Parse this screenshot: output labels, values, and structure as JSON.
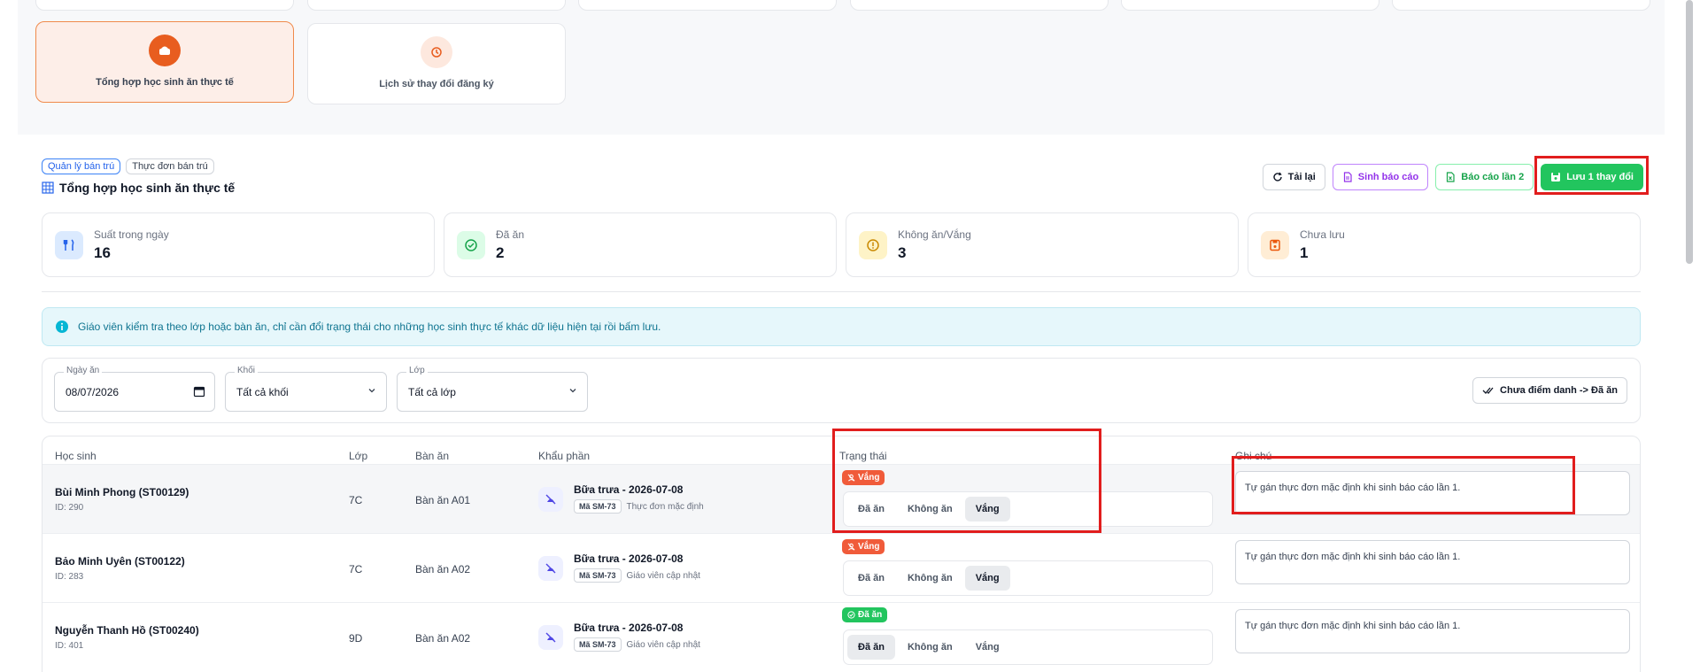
{
  "tiles": [
    {
      "label": "Tổng hợp học sinh ăn thực tế",
      "icon": "meal-box-icon",
      "active": true
    },
    {
      "label": "Lịch sử thay đổi đăng ký",
      "icon": "history-icon",
      "active": false
    }
  ],
  "breadcrumbs": [
    "Quản lý bán trú",
    "Thực đơn bán trú"
  ],
  "page_title": "Tổng hợp học sinh ăn thực tế",
  "actions": {
    "reload": "Tải lại",
    "generate_report": "Sinh báo cáo",
    "report_round2": "Báo cáo lần 2",
    "save": "Lưu 1 thay đổi"
  },
  "stats": [
    {
      "label": "Suất trong ngày",
      "value": "16",
      "icon": "utensils-icon",
      "color": "#3b82f6"
    },
    {
      "label": "Đã ăn",
      "value": "2",
      "icon": "check-circle-icon",
      "color": "#22c55e"
    },
    {
      "label": "Không ăn/Vắng",
      "value": "3",
      "icon": "warning-circle-icon",
      "color": "#eab308"
    },
    {
      "label": "Chưa lưu",
      "value": "1",
      "icon": "unsaved-icon",
      "color": "#f97316"
    }
  ],
  "info_text": "Giáo viên kiểm tra theo lớp hoặc bàn ăn, chỉ cần đổi trạng thái cho những học sinh thực tế khác dữ liệu hiện tại rồi bấm lưu.",
  "filters": {
    "date_label": "Ngày ăn",
    "date_value": "08/07/2026",
    "grade_label": "Khối",
    "grade_value": "Tất cả khối",
    "class_label": "Lớp",
    "class_value": "Tất cả lớp",
    "mark_button": "Chưa điểm danh -> Đã ăn"
  },
  "table": {
    "headers": {
      "student": "Học sinh",
      "class": "Lớp",
      "table": "Bàn ăn",
      "portion": "Khẩu phần",
      "status": "Trạng thái",
      "note": "Ghi chú"
    },
    "status_options": [
      "Đã ăn",
      "Không ăn",
      "Vắng"
    ],
    "rows": [
      {
        "name": "Bùi Minh Phong (ST00129)",
        "id": "ID: 290",
        "class": "7C",
        "table": "Bàn ăn A01",
        "meal": "Bữa trưa - 2026-07-08",
        "code": "Mã SM-73",
        "source": "Thực đơn mặc định",
        "badge": "Vắng",
        "badge_color": "#f05b3a",
        "selected": "Vắng",
        "note": "Tự gán thực đơn mặc định khi sinh báo cáo lần 1."
      },
      {
        "name": "Bảo Minh Uyên (ST00122)",
        "id": "ID: 283",
        "class": "7C",
        "table": "Bàn ăn A02",
        "meal": "Bữa trưa - 2026-07-08",
        "code": "Mã SM-73",
        "source": "Giáo viên cập nhật",
        "badge": "Vắng",
        "badge_color": "#f05b3a",
        "selected": "Vắng",
        "note": "Tự gán thực đơn mặc định khi sinh báo cáo lần 1."
      },
      {
        "name": "Nguyễn Thanh Hồ (ST00240)",
        "id": "ID: 401",
        "class": "9D",
        "table": "Bàn ăn A02",
        "meal": "Bữa trưa - 2026-07-08",
        "code": "Mã SM-73",
        "source": "Giáo viên cập nhật",
        "badge": "Đã ăn",
        "badge_color": "#22c55e",
        "selected": "Đã ăn",
        "note": "Tự gán thực đơn mặc định khi sinh báo cáo lần 1."
      }
    ]
  }
}
